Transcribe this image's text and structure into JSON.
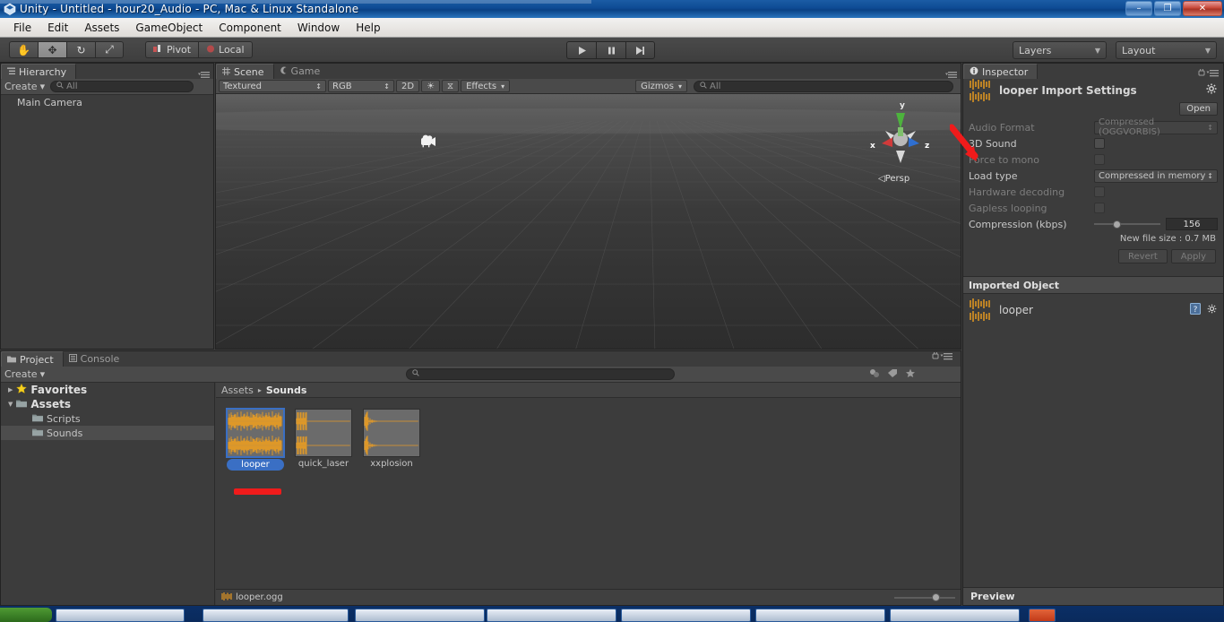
{
  "window": {
    "title": "Unity - Untitled - hour20_Audio - PC, Mac & Linux Standalone",
    "minimize": "–",
    "maximize": "❐",
    "close": "✕"
  },
  "menubar": {
    "items": [
      "File",
      "Edit",
      "Assets",
      "GameObject",
      "Component",
      "Window",
      "Help"
    ]
  },
  "toolbar": {
    "tools": [
      {
        "name": "hand-tool",
        "glyph": "✋",
        "active": false
      },
      {
        "name": "move-tool",
        "glyph": "✥",
        "active": true
      },
      {
        "name": "rotate-tool",
        "glyph": "↻",
        "active": false
      },
      {
        "name": "scale-tool",
        "glyph": "⤢",
        "active": false
      }
    ],
    "pivot_label": "Pivot",
    "local_label": "Local",
    "play_label": "▶",
    "pause_label": "❘❘",
    "step_label": "▶❘",
    "layers_label": "Layers",
    "layout_label": "Layout",
    "dropdown_arrow": "▼"
  },
  "hierarchy": {
    "tab_label": "Hierarchy",
    "create_label": "Create",
    "create_arrow": "▾",
    "search_placeholder": "All",
    "search_value": "",
    "items": [
      {
        "label": "Main Camera"
      }
    ]
  },
  "scene": {
    "tabs": [
      {
        "label": "Scene",
        "active": true
      },
      {
        "label": "Game",
        "active": false
      }
    ],
    "draw_mode": "Textured",
    "color_mode": "RGB",
    "two_d": "2D",
    "light_icon": "☀",
    "audio_icon": "⧖",
    "effects_label": "Effects",
    "gizmos_label": "Gizmos",
    "search_placeholder": "All",
    "gizmo": {
      "y": "y",
      "x": "x",
      "z": "z",
      "persp_label": "Persp",
      "persp_arrow": "◁"
    }
  },
  "project": {
    "tabs": [
      {
        "label": "Project",
        "active": true
      },
      {
        "label": "Console",
        "active": false
      }
    ],
    "create_label": "Create",
    "create_arrow": "▾",
    "tree": [
      {
        "label": "Favorites",
        "kind": "favorites",
        "depth": 0,
        "expanded": false,
        "selected": false
      },
      {
        "label": "Assets",
        "kind": "folder",
        "depth": 0,
        "expanded": true,
        "selected": false
      },
      {
        "label": "Scripts",
        "kind": "folder",
        "depth": 1,
        "expanded": null,
        "selected": false
      },
      {
        "label": "Sounds",
        "kind": "folder",
        "depth": 1,
        "expanded": null,
        "selected": true
      }
    ],
    "breadcrumb": [
      "Assets",
      "Sounds"
    ],
    "breadcrumb_sep": "▸",
    "assets": [
      {
        "label": "looper",
        "selected": true,
        "waveform": "dense"
      },
      {
        "label": "quick_laser",
        "selected": false,
        "waveform": "burst"
      },
      {
        "label": "xxplosion",
        "selected": false,
        "waveform": "decay"
      }
    ],
    "status_file": "looper.ogg"
  },
  "inspector": {
    "tab_label": "Inspector",
    "title": "looper Import Settings",
    "open_label": "Open",
    "gear_icon": "⚙",
    "lock_icon": "ὑ2",
    "fields": [
      {
        "label": "Audio Format",
        "type": "popup",
        "value": "Compressed (OGGVORBIS)",
        "dim": true
      },
      {
        "label": "3D Sound",
        "type": "checkbox",
        "value": "",
        "dim": false,
        "checked": false
      },
      {
        "label": "Force to mono",
        "type": "checkbox",
        "value": "",
        "dim": true,
        "checked": false
      },
      {
        "label": "Load type",
        "type": "popup",
        "value": "Compressed in memory",
        "dim": false
      },
      {
        "label": "Hardware decoding",
        "type": "checkbox",
        "value": "",
        "dim": true,
        "checked": false
      },
      {
        "label": "Gapless looping",
        "type": "checkbox",
        "value": "",
        "dim": true,
        "checked": false
      }
    ],
    "compression_label": "Compression (kbps)",
    "compression_value": "156",
    "filesize_text": "New file size : 0.7 MB",
    "revert_label": "Revert",
    "apply_label": "Apply",
    "imported_object_header": "Imported Object",
    "imported_object_name": "looper",
    "preview_label": "Preview"
  },
  "colors": {
    "accent_blue": "#3a6fc4",
    "waveform_orange": "#f2a01e",
    "annotation_red": "#f01b1b",
    "panel_bg": "#3c3c3c",
    "header_bg": "#4a4a4a",
    "title_blue": "#0e4b94"
  }
}
